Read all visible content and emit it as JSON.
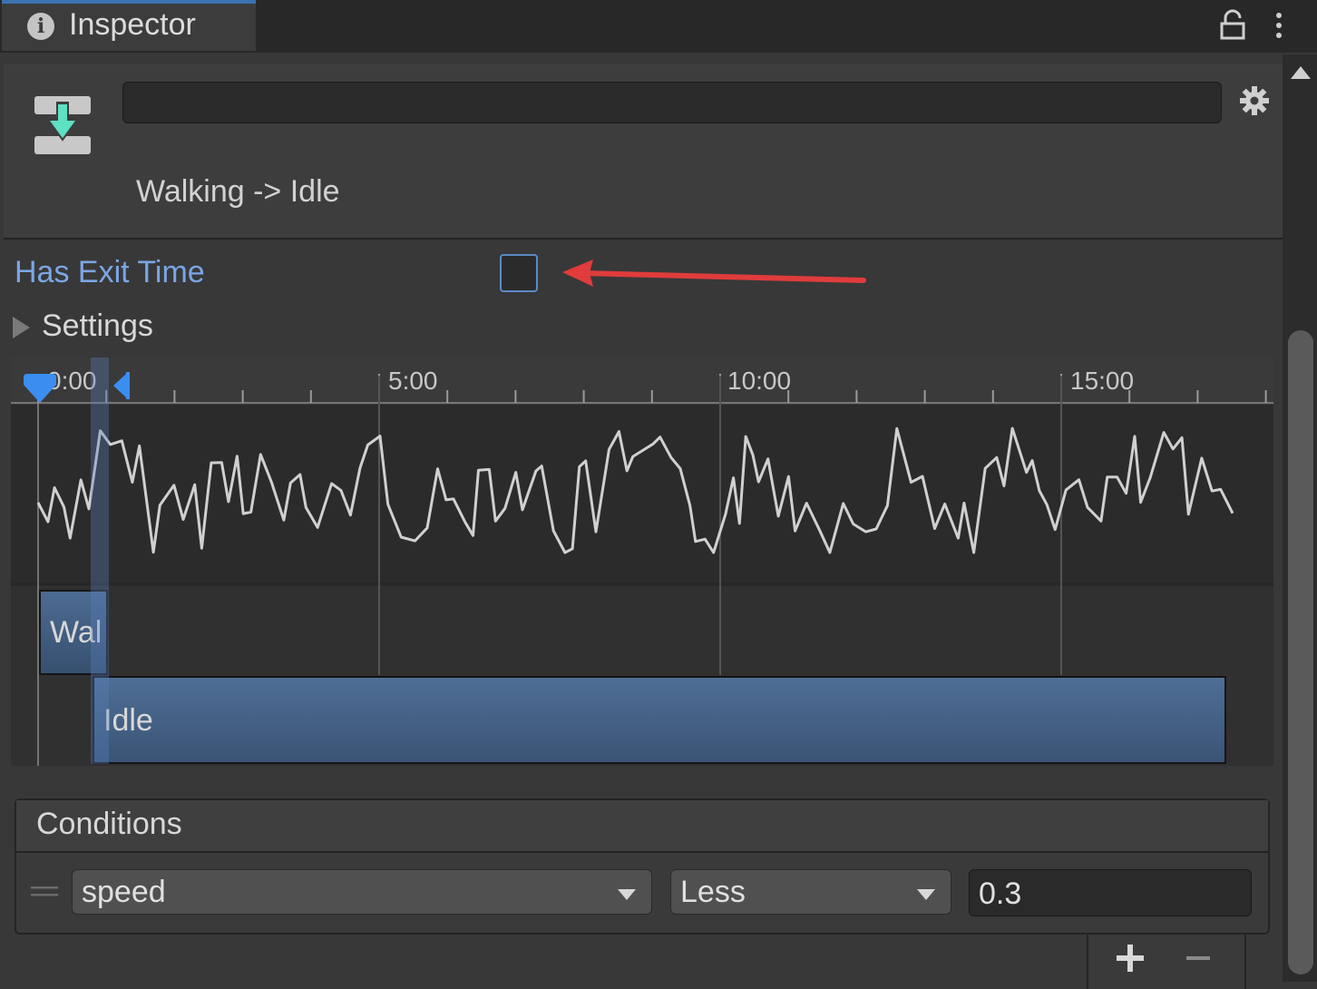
{
  "tab": {
    "title": "Inspector",
    "info_icon": "i"
  },
  "header": {
    "name_value": "",
    "transition_title": "Walking -> Idle"
  },
  "exit_time": {
    "label": "Has Exit Time",
    "checked": false
  },
  "settings": {
    "label": "Settings",
    "expanded": false
  },
  "timeline": {
    "ruler_labels": [
      "0:00",
      "5:00",
      "10:00",
      "15:00"
    ],
    "clips": {
      "from": "Walking",
      "from_visible": "Wal",
      "to": "Idle"
    }
  },
  "conditions": {
    "title": "Conditions",
    "rows": [
      {
        "parameter": "speed",
        "mode": "Less",
        "value": "0.3"
      }
    ],
    "add_label": "+",
    "remove_label": "−"
  },
  "colors": {
    "accent": "#3a72b0",
    "label_blue": "#7ba6e6",
    "annotation_red": "#e03c3c",
    "clip_blue": "#4d6b92"
  }
}
